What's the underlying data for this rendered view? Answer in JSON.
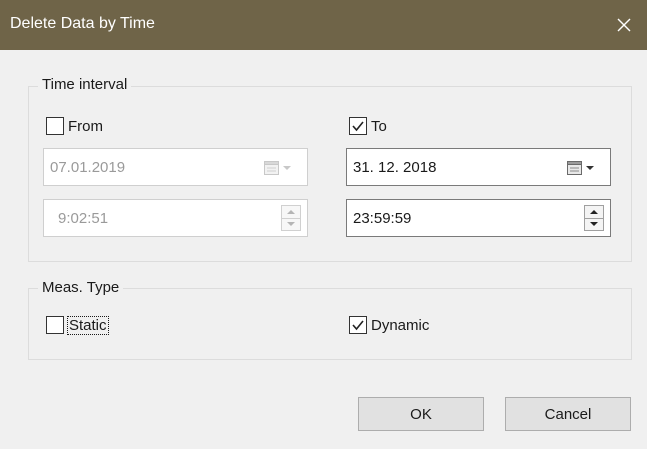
{
  "window": {
    "title": "Delete Data by Time",
    "titlebar_color": "#6f6448"
  },
  "time_interval": {
    "label": "Time interval",
    "from": {
      "label": "From",
      "checked": false,
      "date_value": "07.01.2019",
      "time_value": "9:02:51",
      "enabled": false
    },
    "to": {
      "label": "To",
      "checked": true,
      "date_value": "31. 12. 2018",
      "time_value": "23:59:59",
      "enabled": true
    }
  },
  "meas_type": {
    "label": "Meas. Type",
    "static": {
      "label": "Static",
      "checked": false
    },
    "dynamic": {
      "label": "Dynamic",
      "checked": true
    }
  },
  "buttons": {
    "ok_label": "OK",
    "cancel_label": "Cancel"
  }
}
